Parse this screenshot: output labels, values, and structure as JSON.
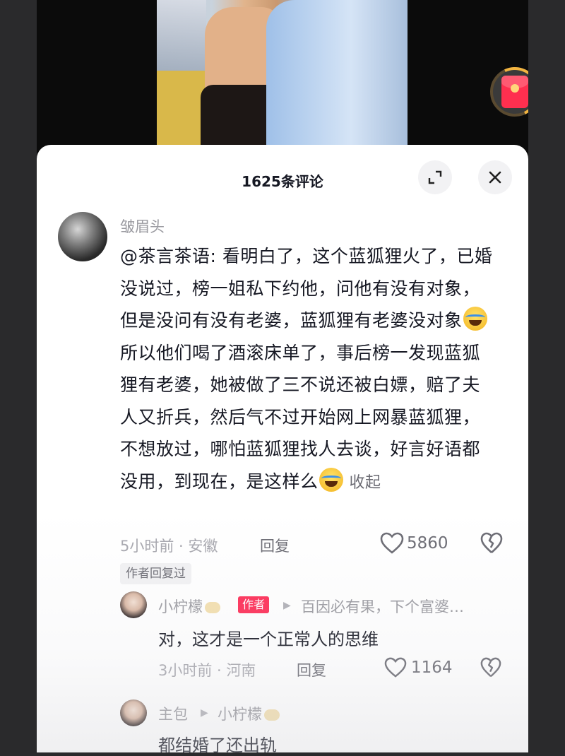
{
  "sheet": {
    "title": "1625条评论"
  },
  "comment": {
    "username": "皱眉头",
    "text": "@茶言茶语: 看明白了，这个蓝狐狸火了，已婚没说过，榜一姐私下约他，问他有没有对象，但是没问有没有老婆，蓝狐狸有老婆没对象",
    "text_2": "所以他们喝了酒滚床单了，事后榜一发现蓝狐狸有老婆，她被做了三不说还被白嫖，赔了夫人又折兵，然后气不过开始网上网暴蓝狐狸，不想放过，哪怕蓝狐狸找人去谈，好言好语都没用，到现在，是这样么",
    "collapse_label": "收起",
    "time_location": "5小时前 · 安徽",
    "reply_label": "回复",
    "like_count": "5860",
    "author_replied_label": "作者回复过"
  },
  "reply1": {
    "username": "小柠檬",
    "badge": "作者",
    "reply_to": "百因必有果，下个富婆…",
    "text": "对，这才是一个正常人的思维",
    "time_location": "3小时前 · 河南",
    "reply_label": "回复",
    "like_count": "1164"
  },
  "reply2": {
    "username": "主包",
    "reply_to": "小柠檬",
    "text": "都结婚了还出轨"
  },
  "icons": {
    "expand": "expand-icon",
    "close": "close-icon",
    "like": "heart-icon",
    "dislike": "broken-heart-icon",
    "redpacket": "red-envelope-icon"
  },
  "colors": {
    "badge": "#fe2c55",
    "text": "#161823",
    "muted": "#9a9aa0"
  }
}
